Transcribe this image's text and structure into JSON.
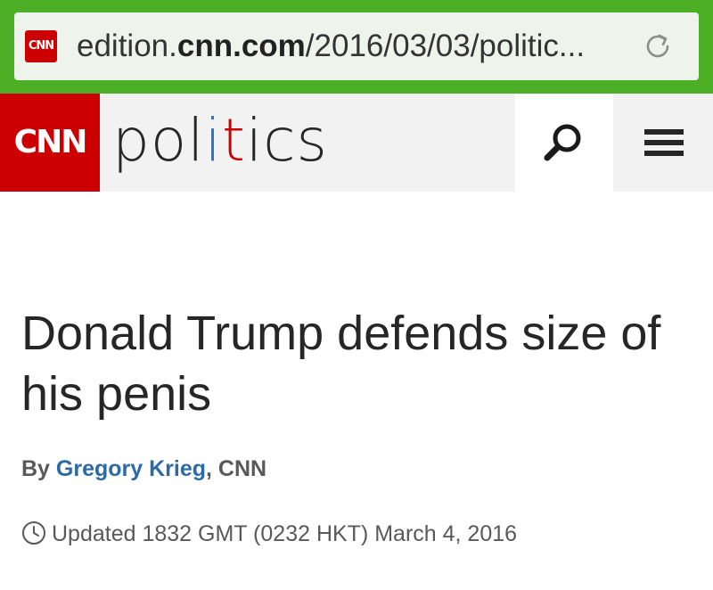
{
  "browser": {
    "favicon_text": "CNN",
    "url_prefix": "edition.",
    "url_domain": "cnn.com",
    "url_path": "/2016/03/03/politic...",
    "reload_icon": "reload-icon",
    "bar_color": "#4caf25"
  },
  "header": {
    "logo_text": "CNN",
    "section_part1": "pol",
    "section_i1": "i",
    "section_t": "t",
    "section_i2": "i",
    "section_part2": "cs",
    "search_icon": "search-icon",
    "menu_icon": "hamburger-menu-icon",
    "brand_color": "#cc0000"
  },
  "article": {
    "headline": "Donald Trump defends size of his penis",
    "byline_prefix": "By ",
    "author": "Gregory Krieg",
    "byline_suffix": ", CNN",
    "timestamp": "Updated 1832 GMT (0232 HKT) March 4, 2016",
    "clock_icon": "clock-icon"
  }
}
